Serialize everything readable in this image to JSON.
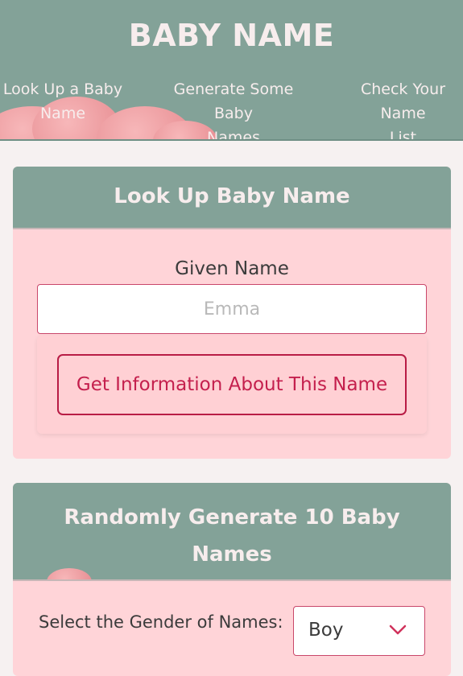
{
  "header": {
    "title": "BABY NAME",
    "nav": [
      {
        "line1": "Look Up a Baby",
        "line2": "Name"
      },
      {
        "line1": "Generate Some Baby",
        "line2": "Names"
      },
      {
        "line1": "Check Your Name",
        "line2": "List"
      }
    ]
  },
  "lookup_card": {
    "title": "Look Up Baby Name",
    "field_label": "Given Name",
    "input_value": "",
    "input_placeholder": "Emma",
    "button_label": "Get Information About This Name"
  },
  "generate_card": {
    "title_line1": "Randomly Generate 10 Baby",
    "title_line2": "Names",
    "gender_label": "Select the Gender of Names:",
    "gender_selected": "Boy"
  },
  "colors": {
    "accent_green": "#83a298",
    "card_pink": "#ffd4d8",
    "button_red": "#c41f4d"
  }
}
